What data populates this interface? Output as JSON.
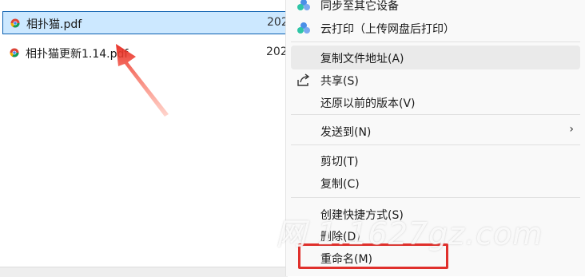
{
  "files": [
    {
      "name": "相扑猫.pdf",
      "date": "202",
      "selected": true
    },
    {
      "name": "相扑猫更新1.14.pdf",
      "date": "202",
      "selected": false
    }
  ],
  "context_menu": {
    "items": [
      {
        "label": "同步至其它设备",
        "icon": "sync-devices-icon"
      },
      {
        "label": "云打印（上传网盘后打印）",
        "icon": "cloud-print-icon"
      },
      {
        "label": "复制文件地址(A)",
        "icon": ""
      },
      {
        "label": "共享(S)",
        "icon": "share-icon"
      },
      {
        "label": "还原以前的版本(V)",
        "icon": ""
      },
      {
        "label": "发送到(N)",
        "icon": "",
        "submenu": true
      },
      {
        "label": "剪切(T)",
        "icon": ""
      },
      {
        "label": "复制(C)",
        "icon": ""
      },
      {
        "label": "创建快捷方式(S)",
        "icon": ""
      },
      {
        "label": "删除(D)",
        "icon": ""
      },
      {
        "label": "重命名(M)",
        "icon": ""
      }
    ],
    "submenu_chevron": "›"
  },
  "watermark": "网 1.1627gz.com",
  "colors": {
    "selection_bg": "#cce8ff",
    "selection_border": "#0a5fb0",
    "annotation_red": "#e0302c",
    "menu_bg": "#f9f9f9"
  }
}
